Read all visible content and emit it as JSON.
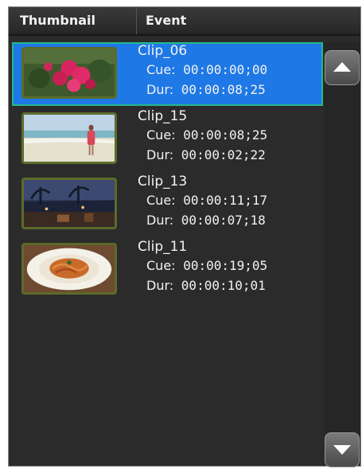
{
  "header": {
    "thumbnail_label": "Thumbnail",
    "event_label": "Event"
  },
  "events": [
    {
      "title": "Clip_06",
      "cue_label": "Cue:",
      "cue": "00:00:00;00",
      "dur_label": "Dur:",
      "dur": "00:00:08;25",
      "thumbnail": "pink-flowers",
      "selected": true
    },
    {
      "title": "Clip_15",
      "cue_label": "Cue:",
      "cue": "00:00:08;25",
      "dur_label": "Dur:",
      "dur": "00:00:02;22",
      "thumbnail": "beach-woman",
      "selected": false
    },
    {
      "title": "Clip_13",
      "cue_label": "Cue:",
      "cue": "00:00:11;17",
      "dur_label": "Dur:",
      "dur": "00:00:07;18",
      "thumbnail": "dusk-restaurant",
      "selected": false
    },
    {
      "title": "Clip_11",
      "cue_label": "Cue:",
      "cue": "00:00:19;05",
      "dur_label": "Dur:",
      "dur": "00:00:10;01",
      "thumbnail": "pasta-plate",
      "selected": false
    }
  ],
  "scrollbar": {
    "up_icon": "triangle-up-icon",
    "down_icon": "triangle-down-icon"
  },
  "colors": {
    "selection": "#1e78e6",
    "selection_border": "#24b88a",
    "panel": "#2b2b2b",
    "thumb_frame": "#5c6b2a"
  }
}
